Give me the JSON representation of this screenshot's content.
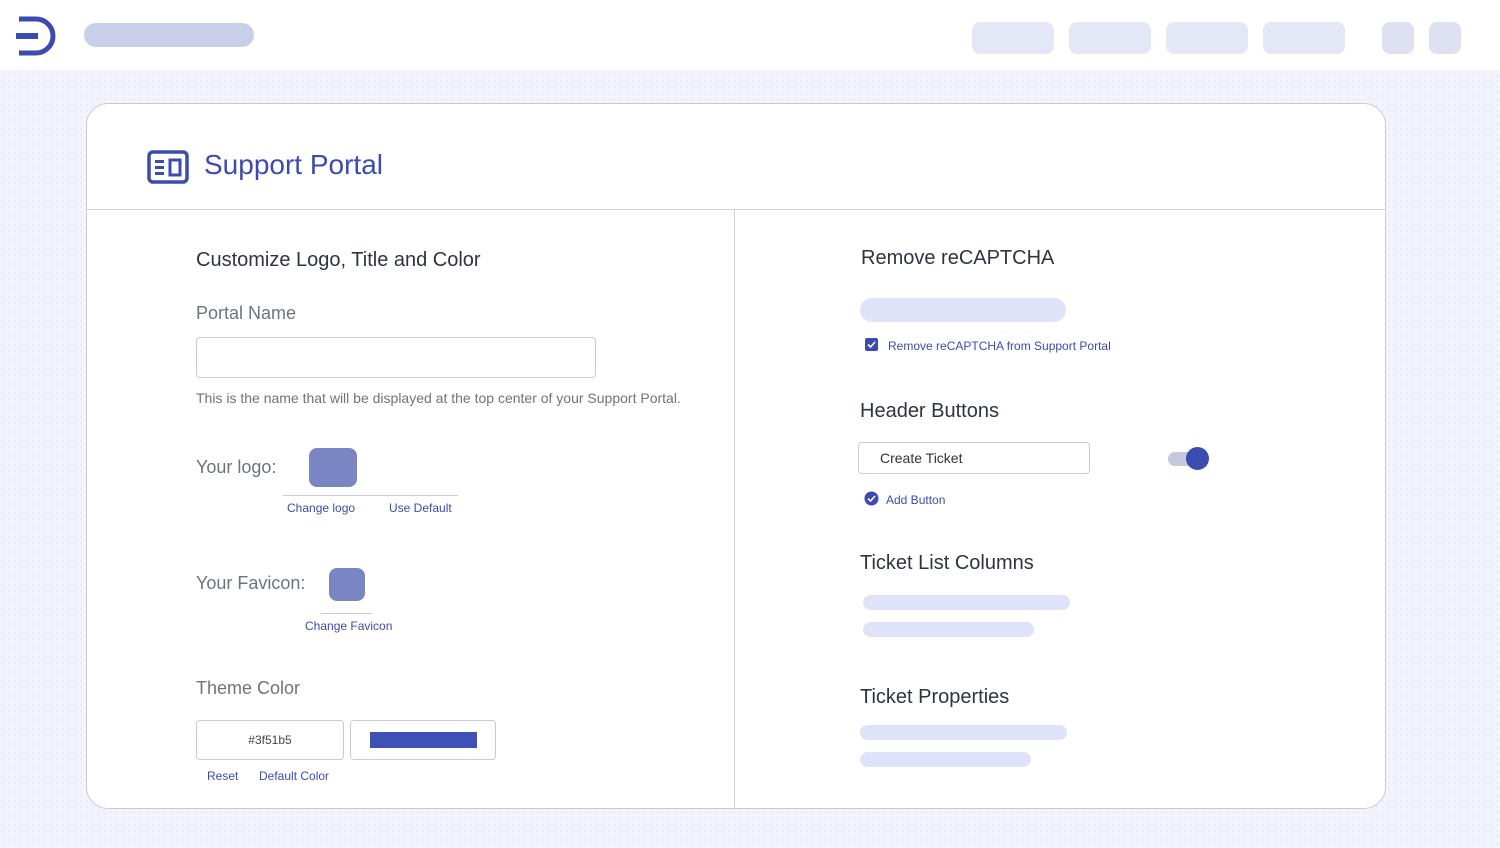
{
  "colors": {
    "accent": "#3b4bb0",
    "theme": "#3f51b5",
    "logo_placeholder": "#7a85c4"
  },
  "topbar": {
    "logo_icon": "d-logo-icon",
    "nav_button_count": 4,
    "icon_button_count": 2
  },
  "header": {
    "icon": "portal-layout-icon",
    "title": "Support Portal"
  },
  "left": {
    "section_title": "Customize Logo, Title and Color",
    "portal_name": {
      "label": "Portal Name",
      "value": "",
      "help": "This is the name that will be displayed at the top center of your Support Portal."
    },
    "logo": {
      "label": "Your logo:",
      "change_label": "Change logo",
      "default_label": "Use Default"
    },
    "favicon": {
      "label": "Your Favicon:",
      "change_label": "Change Favicon"
    },
    "theme": {
      "label": "Theme Color",
      "value": "#3f51b5",
      "reset_label": "Reset",
      "default_label": "Default Color"
    }
  },
  "right": {
    "recaptcha": {
      "title": "Remove reCAPTCHA",
      "checkbox_label": "Remove reCAPTCHA from Support Portal",
      "checked": true
    },
    "header_buttons": {
      "title": "Header Buttons",
      "button_value": "Create Ticket",
      "toggle_on": true,
      "add_label": "Add Button"
    },
    "ticket_list": {
      "title": "Ticket List Columns"
    },
    "ticket_properties": {
      "title": "Ticket Properties"
    }
  }
}
